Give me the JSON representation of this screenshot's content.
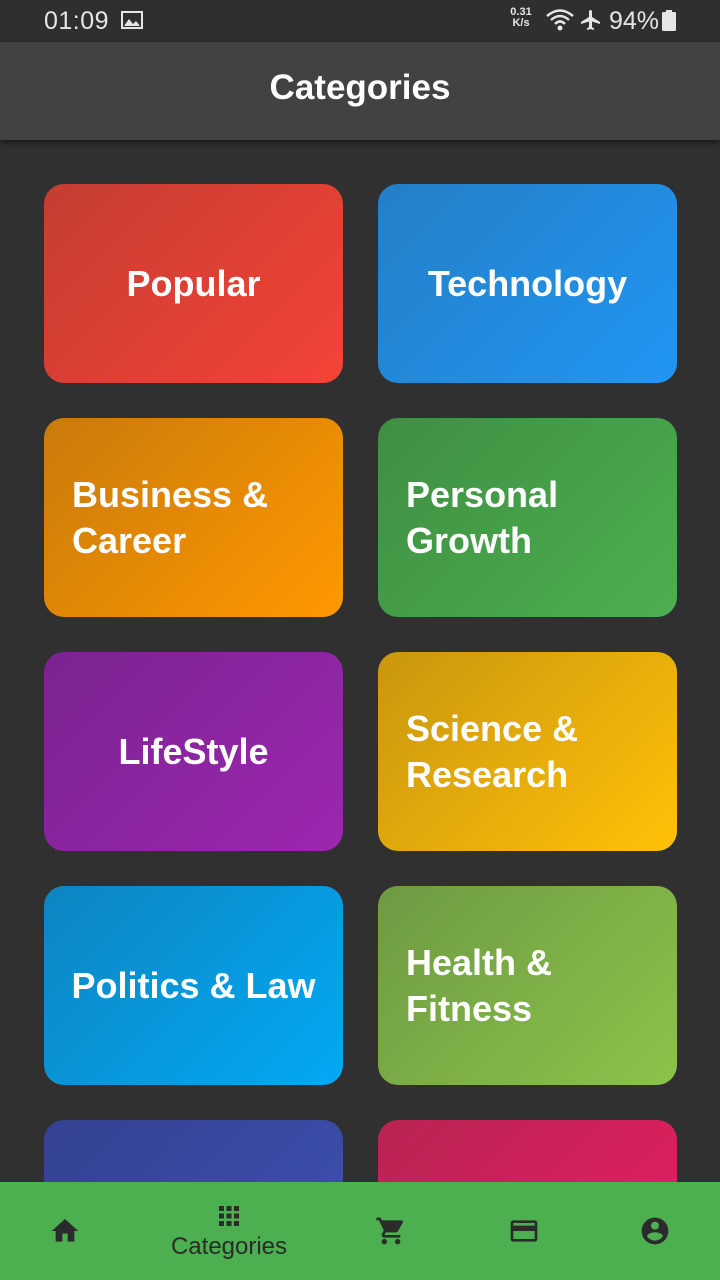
{
  "status_bar": {
    "time": "01:09",
    "speed_value": "0.31",
    "speed_unit": "K/s",
    "battery": "94%"
  },
  "app_bar": {
    "title": "Categories"
  },
  "categories": [
    {
      "label": "Popular",
      "colors": [
        "#c53d33",
        "#f44336"
      ]
    },
    {
      "label": "Technology",
      "colors": [
        "#247fc7",
        "#2196f3"
      ]
    },
    {
      "label": "Business &\nCareer",
      "colors": [
        "#c97a0b",
        "#ff9800"
      ]
    },
    {
      "label": "Personal\nGrowth",
      "colors": [
        "#3f8f42",
        "#4caf50"
      ]
    },
    {
      "label": "LifeStyle",
      "colors": [
        "#7b2390",
        "#9c27b0"
      ]
    },
    {
      "label": "Science &\nResearch",
      "colors": [
        "#c9960f",
        "#ffc107"
      ]
    },
    {
      "label": "Politics & Law",
      "colors": [
        "#0d85c2",
        "#03a9f4"
      ]
    },
    {
      "label": "Health &\nFitness",
      "colors": [
        "#6e9a43",
        "#8bc34a"
      ]
    },
    {
      "label": "",
      "colors": [
        "#344290",
        "#3f51b5"
      ]
    },
    {
      "label": "",
      "colors": [
        "#b82452",
        "#e91e63"
      ]
    }
  ],
  "bottom_nav": {
    "items": [
      {
        "icon": "home-icon"
      },
      {
        "icon": "apps-grid-icon",
        "label": "Categories"
      },
      {
        "icon": "cart-icon"
      },
      {
        "icon": "credit-card-icon"
      },
      {
        "icon": "account-circle-icon"
      }
    ],
    "icon_color": "#2b2b2b",
    "background": "#4caf50"
  }
}
